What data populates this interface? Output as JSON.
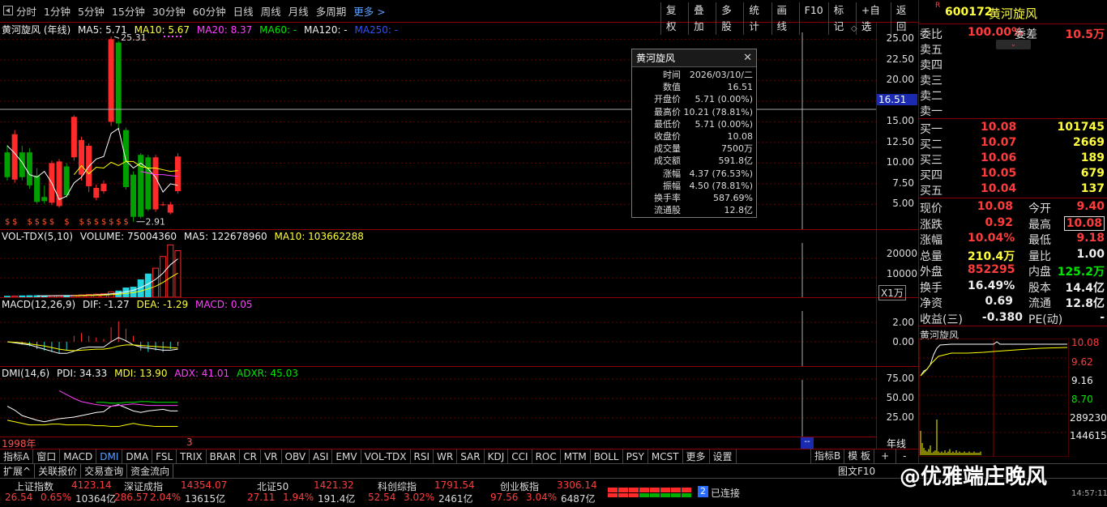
{
  "toolbar": {
    "back_icon": "square-back-icon",
    "periods": [
      "分时",
      "1分钟",
      "5分钟",
      "15分钟",
      "30分钟",
      "60分钟",
      "日线",
      "周线",
      "月线",
      "多周期",
      "更多 >"
    ],
    "tools": [
      "复权",
      "叠加",
      "多股",
      "统计",
      "画线",
      "F10",
      "标记",
      "+自选",
      "返回"
    ]
  },
  "main": {
    "head": {
      "name": "黄河旋风 (年线)",
      "ma5": "MA5: 5.71",
      "ma10": "MA10: 5.67",
      "ma20": "MA20: 8.37",
      "ma60": "MA60: -",
      "ma120": "MA120: -",
      "ma250": "MA250: -"
    },
    "axis": [
      "25.00",
      "22.50",
      "20.00",
      "17.50",
      "15.00",
      "12.50",
      "10.00",
      "7.50",
      "5.00"
    ],
    "cursor_price": "16.51",
    "high_label": "25.31",
    "low_label": "2.91",
    "colors": {
      "up": "#ff2a2a",
      "down": "#00a000",
      "ma5": "#ffffff",
      "ma10": "#ffff00",
      "ma20": "#ff40ff",
      "grid": "#8b0000"
    }
  },
  "chart_data": {
    "type": "candlestick",
    "candles": [
      {
        "o": 11.3,
        "c": 8.3,
        "h": 12.2,
        "l": 7.9
      },
      {
        "o": 8.0,
        "c": 13.5,
        "h": 14.0,
        "l": 7.6
      },
      {
        "o": 11.3,
        "c": 8.3,
        "h": 12.1,
        "l": 7.9
      },
      {
        "o": 11.3,
        "c": 7.3,
        "h": 11.8,
        "l": 6.9
      },
      {
        "o": 8.5,
        "c": 5.3,
        "h": 9.4,
        "l": 5.1
      },
      {
        "o": 5.9,
        "c": 5.4,
        "h": 7.3,
        "l": 5.1
      },
      {
        "o": 5.2,
        "c": 10.0,
        "h": 10.3,
        "l": 4.9
      },
      {
        "o": 4.8,
        "c": 10.2,
        "h": 10.5,
        "l": 4.6
      },
      {
        "o": 9.6,
        "c": 6.1,
        "h": 10.0,
        "l": 5.8
      },
      {
        "o": 10.7,
        "c": 15.6,
        "h": 15.8,
        "l": 10.3
      },
      {
        "o": 8.6,
        "c": 12.8,
        "h": 13.2,
        "l": 7.9
      },
      {
        "o": 7.2,
        "c": 12.1,
        "h": 12.4,
        "l": 6.5
      },
      {
        "o": 5.8,
        "c": 7.0,
        "h": 7.4,
        "l": 5.5
      },
      {
        "o": 6.6,
        "c": 7.5,
        "h": 7.9,
        "l": 6.3
      },
      {
        "o": 15.0,
        "c": 25.0,
        "h": 25.31,
        "l": 14.5
      },
      {
        "o": 24.6,
        "c": 14.8,
        "h": 24.8,
        "l": 14.2
      },
      {
        "o": 14.0,
        "c": 7.1,
        "h": 14.3,
        "l": 6.8
      },
      {
        "o": 8.6,
        "c": 3.5,
        "h": 9.0,
        "l": 2.91
      },
      {
        "o": 11.0,
        "c": 3.5,
        "h": 11.2,
        "l": 3.3
      },
      {
        "o": 10.7,
        "c": 4.4,
        "h": 11.0,
        "l": 4.2
      },
      {
        "o": 4.4,
        "c": 10.7,
        "h": 11.0,
        "l": 4.1
      },
      {
        "o": 5.0,
        "c": 5.0,
        "h": 5.3,
        "l": 4.8
      },
      {
        "o": 4.0,
        "c": 5.0,
        "h": 5.3,
        "l": 3.8
      },
      {
        "o": 6.6,
        "c": 10.8,
        "h": 11.2,
        "l": 6.3
      }
    ],
    "ylim": [
      2,
      27
    ],
    "ma5": [
      12.1,
      11.2,
      10.1,
      8.6,
      8.3,
      9.0,
      7.6,
      5.6,
      6.0,
      7.6,
      8.3,
      9.6,
      10.5,
      10.8,
      13.6,
      14.2,
      10.3,
      9.4,
      10.0,
      9.3,
      8.3,
      6.5,
      7.5,
      7.3
    ],
    "ma10": [
      null,
      null,
      null,
      null,
      null,
      null,
      null,
      null,
      null,
      8.6,
      9.7,
      8.7,
      9.5,
      9.4,
      10.1,
      9.7,
      10.2,
      10.2,
      9.6,
      9.4,
      9.4,
      9.2,
      9.0,
      9.1
    ],
    "ma20": [
      null,
      null,
      null,
      null,
      null,
      null,
      null,
      null,
      null,
      null,
      null,
      null,
      null,
      null,
      null,
      null,
      null,
      null,
      9.0,
      8.8,
      8.6,
      8.6,
      8.5,
      8.4
    ],
    "dollar_marks": [
      0,
      1,
      3,
      4,
      5,
      6,
      8,
      10,
      11,
      12,
      13,
      14,
      15,
      16
    ],
    "time_label": "1998年"
  },
  "tooltip": {
    "title": "黄河旋风",
    "rows": [
      {
        "k": "时间",
        "v": "2026/03/10/二",
        "c": "wht"
      },
      {
        "k": "数值",
        "v": "16.51",
        "c": "wht"
      },
      {
        "k": "开盘价",
        "v": "5.71 (0.00%)",
        "c": "wht"
      },
      {
        "k": "最高价",
        "v": "10.21 (78.81%)",
        "c": "red"
      },
      {
        "k": "最低价",
        "v": "5.71 (0.00%)",
        "c": "wht"
      },
      {
        "k": "收盘价",
        "v": "10.08",
        "c": "red"
      },
      {
        "k": "成交量",
        "v": "7500万",
        "c": "yel"
      },
      {
        "k": "成交额",
        "v": "591.8亿",
        "c": "wht"
      },
      {
        "k": "涨幅",
        "v": "4.37 (76.53%)",
        "c": "red"
      },
      {
        "k": "振幅",
        "v": "4.50 (78.81%)",
        "c": "wht"
      },
      {
        "k": "换手率",
        "v": "587.69%",
        "c": "wht"
      },
      {
        "k": "流通股",
        "v": "12.8亿",
        "c": "wht"
      }
    ]
  },
  "vol": {
    "head": {
      "name": "VOL-TDX(5,10)",
      "volume": "VOLUME: 75004360",
      "ma5": "MA5: 122678960",
      "ma10": "MA10: 103662288"
    },
    "axis": [
      "20000",
      "10000"
    ],
    "unit": "X1万",
    "values": [
      5,
      6,
      7,
      8,
      8,
      7,
      8,
      9,
      9,
      10,
      12,
      14,
      16,
      18,
      28,
      32,
      48,
      52,
      90,
      120,
      150,
      210,
      270,
      240
    ]
  },
  "macd": {
    "head": {
      "name": "MACD(12,26,9)",
      "dif": "DIF: -1.27",
      "dea": "DEA: -1.29",
      "macd": "MACD: 0.05"
    },
    "axis": [
      "2.00",
      "0.00"
    ]
  },
  "dmi": {
    "head": {
      "name": "DMI(14,6)",
      "pdi": "PDI: 34.33",
      "mdi": "MDI: 13.90",
      "adx": "ADX: 41.01",
      "adxr": "ADXR: 45.03"
    },
    "axis": [
      "75.00",
      "50.00",
      "25.00"
    ],
    "year_label": "年线"
  },
  "tabs": [
    "指标A",
    "窗口",
    "MACD",
    "DMI",
    "DMA",
    "FSL",
    "TRIX",
    "BRAR",
    "CR",
    "VR",
    "OBV",
    "ASI",
    "EMV",
    "VOL-TDX",
    "RSI",
    "WR",
    "SAR",
    "KDJ",
    "CCI",
    "ROC",
    "MTM",
    "BOLL",
    "PSY",
    "MCST",
    "更多",
    "设置"
  ],
  "tabs_right": [
    "指标B",
    "模 板",
    "+",
    "-"
  ],
  "status2": [
    "扩展^",
    "关联报价",
    "交易查询",
    "资金流向"
  ],
  "status2_right": "图文F10",
  "quote": {
    "code": "600172",
    "name": "黄河旋风",
    "flag": "R",
    "webi": {
      "k1": "委比",
      "v1": "100.00%",
      "k2": "委差",
      "v2": "10.5万"
    },
    "sells": [
      "卖五",
      "卖四",
      "卖三",
      "卖二",
      "卖一"
    ],
    "buys": [
      {
        "k": "买一",
        "p": "10.08",
        "v": "101745"
      },
      {
        "k": "买二",
        "p": "10.07",
        "v": "2669"
      },
      {
        "k": "买三",
        "p": "10.06",
        "v": "189"
      },
      {
        "k": "买四",
        "p": "10.05",
        "v": "679"
      },
      {
        "k": "买五",
        "p": "10.04",
        "v": "137"
      }
    ],
    "stats": [
      {
        "k1": "现价",
        "v1": "10.08",
        "c1": "red",
        "k2": "今开",
        "v2": "9.40",
        "c2": "red"
      },
      {
        "k1": "涨跌",
        "v1": "0.92",
        "c1": "red",
        "k2": "最高",
        "v2": "10.08",
        "c2": "red"
      },
      {
        "k1": "涨幅",
        "v1": "10.04%",
        "c1": "red",
        "k2": "最低",
        "v2": "9.18",
        "c2": "red"
      },
      {
        "k1": "总量",
        "v1": "210.4万",
        "c1": "yel",
        "k2": "量比",
        "v2": "1.00",
        "c2": "wht"
      },
      {
        "k1": "外盘",
        "v1": "852295",
        "c1": "red",
        "k2": "内盘",
        "v2": "125.2万",
        "c2": "grn"
      },
      {
        "k1": "换手",
        "v1": "16.49%",
        "c1": "wht",
        "k2": "股本",
        "v2": "14.4亿",
        "c2": "wht"
      },
      {
        "k1": "净资",
        "v1": "0.69",
        "c1": "wht",
        "k2": "流通",
        "v2": "12.8亿",
        "c2": "wht"
      },
      {
        "k1": "收益(三)",
        "v1": "-0.380",
        "c1": "wht",
        "k2": "PE(动)",
        "v2": "-",
        "c2": "wht"
      }
    ],
    "mini_title": "黄河旋风",
    "mini_axis": [
      "10.08",
      "9.62",
      "9.16",
      "8.70",
      "289230",
      "144615"
    ]
  },
  "ticker": [
    {
      "name": "上证指数",
      "val": "4123.14",
      "chg": "26.54",
      "pct": "0.65%",
      "amt": "10364亿"
    },
    {
      "name": "深证成指",
      "val": "14354.07",
      "chg": "286.57",
      "pct": "2.04%",
      "amt": "13615亿"
    },
    {
      "name": "北证50",
      "val": "1421.32",
      "chg": "27.11",
      "pct": "1.94%",
      "amt": "191.4亿"
    },
    {
      "name": "科创综指",
      "val": "1791.54",
      "chg": "52.54",
      "pct": "3.02%",
      "amt": "2461亿"
    },
    {
      "name": "创业板指",
      "val": "3306.14",
      "chg": "97.56",
      "pct": "3.04%",
      "amt": "6487亿"
    }
  ],
  "connection": {
    "num": "2",
    "label": "已连接",
    "time": "14:57:11"
  },
  "watermark": "@优雅端庄晚风"
}
